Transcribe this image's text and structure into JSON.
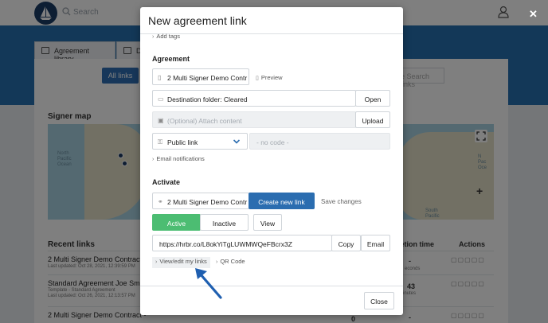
{
  "background": {
    "search_placeholder": "Search",
    "tabs": [
      "Agreement library",
      "D"
    ],
    "all_links": "All links",
    "search_links_placeholder": "e Search links",
    "signer_map_title": "Signer map",
    "map_labels": {
      "north_pacific": "North\nPacific\nOcean",
      "ocean_right": "N\nPac\nOce",
      "south_pacific": "South\nPacific"
    },
    "recent_links_title": "Recent links",
    "col_completion": "letion time",
    "col_actions": "Actions",
    "rows": [
      {
        "title": "2 Multi Signer Demo Contract -",
        "sub": "Last updated: Oct 28, 2021, 12:39:59 PM",
        "count": "-",
        "count_sub": "econds"
      },
      {
        "title": "Standard Agreement Joe Smith",
        "sub": "Template - Standard Agreement\nLast updated: Oct 26, 2021, 12:13:57 PM",
        "count": "43",
        "count_sub": "inutes"
      },
      {
        "title": "2 Multi Signer Demo Contract -",
        "sub": "",
        "count": "-",
        "count_sub": ""
      }
    ],
    "zero": "0"
  },
  "modal": {
    "title": "New agreement link",
    "add_tags": "Add tags",
    "agreement_heading": "Agreement",
    "agreement_field": "2 Multi Signer Demo Contr",
    "preview": "Preview",
    "destination": "Destination folder: Cleared",
    "open": "Open",
    "attach_placeholder": "(Optional) Attach content",
    "upload": "Upload",
    "link_type": "Public link",
    "no_code": "- no code -",
    "email_notifications": "Email notifications",
    "activate_heading": "Activate",
    "activate_field": "2 Multi Signer Demo Contr",
    "create_new_link": "Create new link",
    "save_changes": "Save changes",
    "active": "Active",
    "inactive": "Inactive",
    "view": "View",
    "url": "https://hrbr.co/L8okYiTgLUWMWQeFBcrx3Z",
    "copy": "Copy",
    "email": "Email",
    "view_edit_links": "View/edit my links",
    "qr_code": "QR Code",
    "close": "Close"
  },
  "colors": {
    "brand_blue": "#2770b1",
    "primary_button": "#2b6db0",
    "active_green": "#4cbd72",
    "annotation_arrow": "#1f5fb0"
  }
}
